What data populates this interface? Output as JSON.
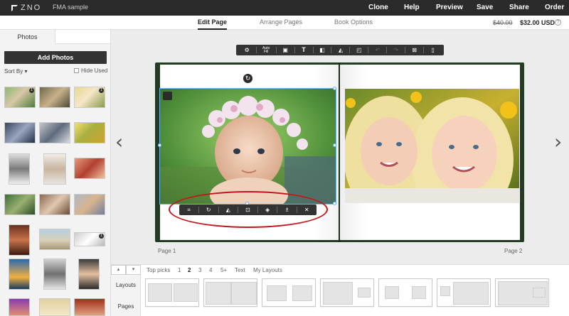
{
  "topbar": {
    "logo": "ZNO",
    "project_name": "FMA sample",
    "nav": {
      "clone": "Clone",
      "help": "Help",
      "preview": "Preview",
      "save": "Save",
      "share": "Share",
      "order": "Order"
    }
  },
  "subbar": {
    "tabs": [
      "Edit Page",
      "Arrange Pages",
      "Book Options"
    ],
    "active_tab": "Edit Page",
    "price_old": "$40.00",
    "price_new": "$32.00 USD"
  },
  "left_panel": {
    "tab": "Photos",
    "add_photos": "Add Photos",
    "sort_by": "Sort By ▾",
    "hide_used": "Hide Used",
    "badges": [
      "1",
      "1",
      "1"
    ]
  },
  "toolbar": {
    "auto_fill": "Auto Fill",
    "icons": [
      "settings-icon",
      "auto-fill-icon",
      "frame-icon",
      "text-icon",
      "layers-icon",
      "flip-icon",
      "sticker-icon",
      "undo-icon",
      "redo-icon",
      "clear-icon",
      "trash-icon"
    ]
  },
  "photo_toolbar": {
    "icons": [
      "crop-icon",
      "rotate-icon",
      "flip-icon",
      "fit-icon",
      "layers-icon",
      "filter-icon",
      "close-icon"
    ]
  },
  "pages": {
    "left": "Page 1",
    "right": "Page 2"
  },
  "tray": {
    "filters": [
      "Top picks",
      "1",
      "2",
      "3",
      "4",
      "5+",
      "Text",
      "My Layouts"
    ],
    "active_filter": "2",
    "side": [
      "Layouts",
      "Pages"
    ]
  },
  "colors": {
    "accent_red": "#c4161c",
    "selection_blue": "#6bb3e8",
    "book_cover": "#233a23",
    "topbar": "#2b2b2b"
  }
}
